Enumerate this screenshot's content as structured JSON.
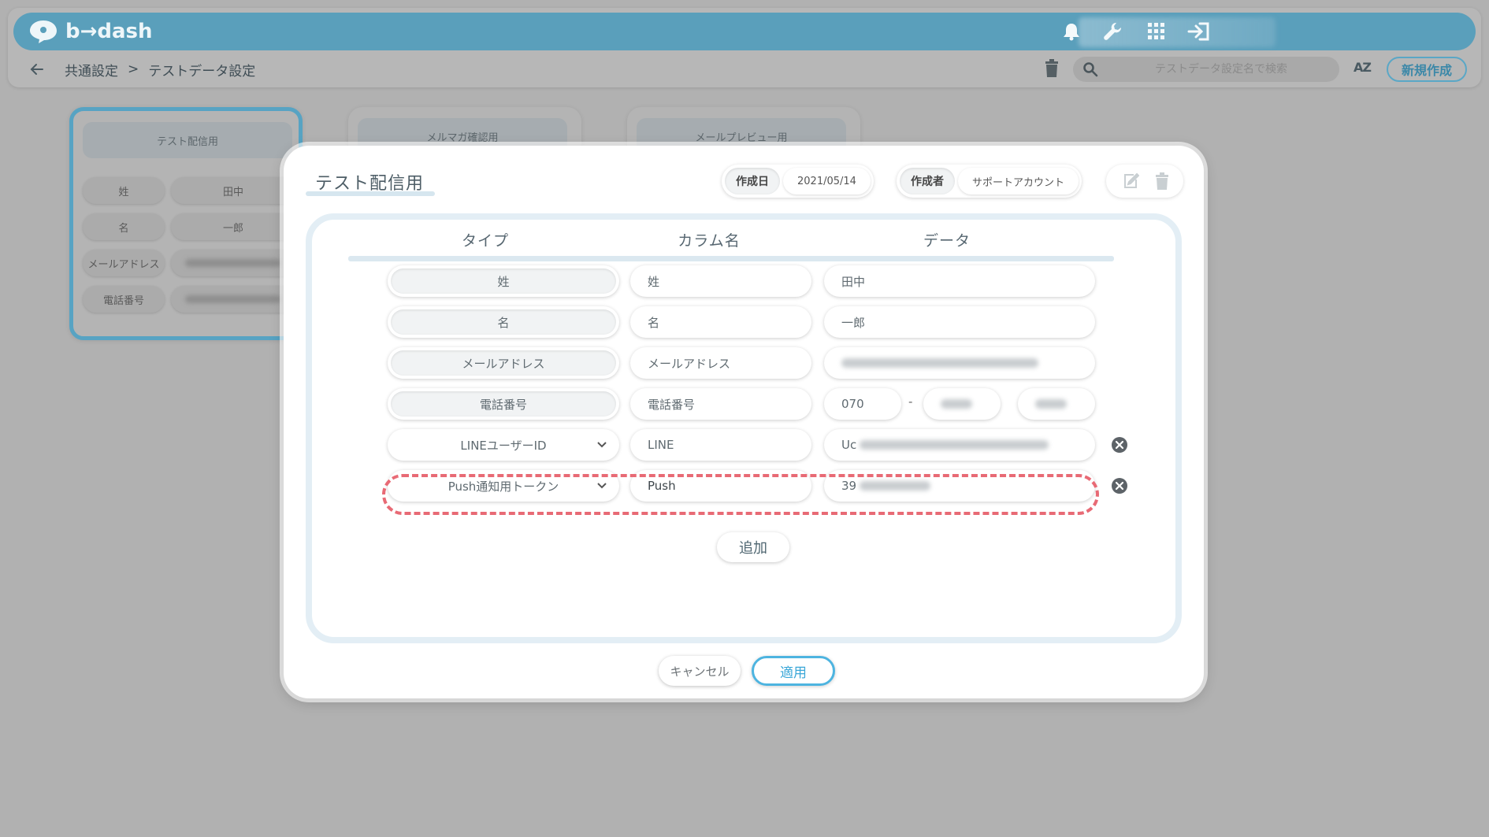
{
  "app": {
    "logo_text": "b→dash",
    "accent_color": "#5a9fbb"
  },
  "header_icons": [
    "bell-icon",
    "wrench-icon",
    "grid-icon",
    "logout-icon"
  ],
  "breadcrumb": {
    "parent": "共通設定",
    "separator": ">",
    "current": "テストデータ設定"
  },
  "toolbar": {
    "search_placeholder": "テストデータ設定名で検索",
    "sort_label": "AZ",
    "new_button": "新規作成"
  },
  "background_cards": [
    {
      "title": "テスト配信用",
      "rows": [
        {
          "label": "姓",
          "value": "田中"
        },
        {
          "label": "名",
          "value": "一郎"
        },
        {
          "label": "メールアドレス",
          "value": ""
        },
        {
          "label": "電話番号",
          "value": ""
        }
      ]
    },
    {
      "title": "メルマガ確認用"
    },
    {
      "title": "メールプレビュー用"
    }
  ],
  "modal": {
    "title": "テスト配信用",
    "created_date_label": "作成日",
    "created_date": "2021/05/14",
    "creator_label": "作成者",
    "creator": "サポートアカウント",
    "columns": {
      "type": "タイプ",
      "column_name": "カラム名",
      "data": "データ"
    },
    "rows": [
      {
        "type": "姓",
        "column_name": "姓",
        "data": "田中"
      },
      {
        "type": "名",
        "column_name": "名",
        "data": "一郎"
      },
      {
        "type": "メールアドレス",
        "column_name": "メールアドレス",
        "data": ""
      },
      {
        "type": "電話番号",
        "column_name": "電話番号",
        "data_parts": [
          "070",
          "",
          ""
        ],
        "separator": "-"
      },
      {
        "type": "LINEユーザーID",
        "column_name": "LINE",
        "data_prefix": "Uc"
      },
      {
        "type": "Push通知用トークン",
        "column_name": "Push",
        "data_prefix": "39"
      }
    ],
    "add_button": "追加",
    "cancel_button": "キャンセル",
    "apply_button": "適用"
  }
}
